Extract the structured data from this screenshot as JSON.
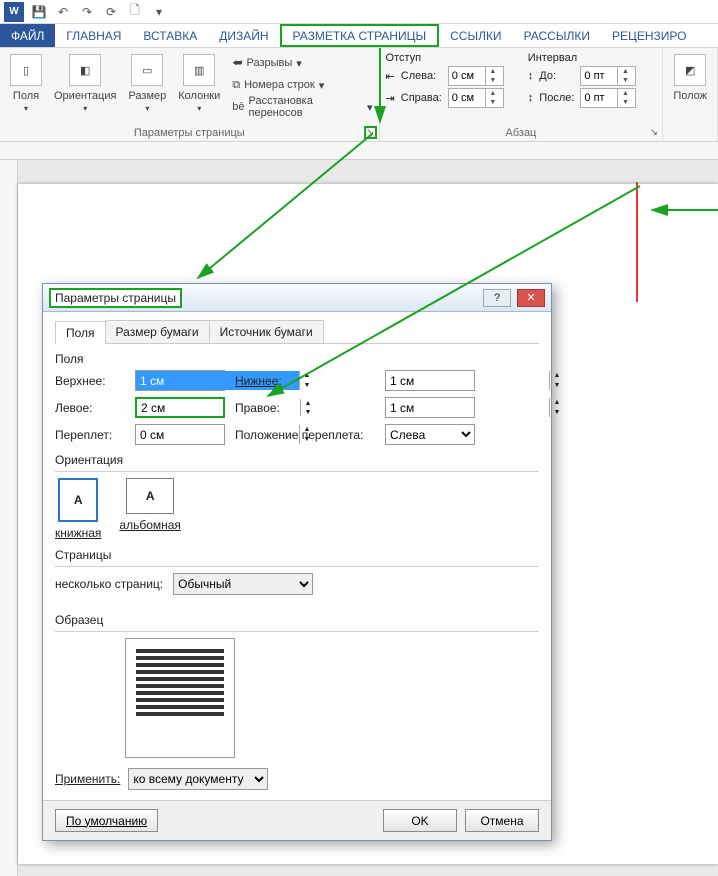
{
  "qat": {
    "app": "W"
  },
  "tabs": {
    "file": "ФАЙЛ",
    "items": [
      "ГЛАВНАЯ",
      "ВСТАВКА",
      "ДИЗАЙН",
      "РАЗМЕТКА СТРАНИЦЫ",
      "ССЫЛКИ",
      "РАССЫЛКИ",
      "РЕЦЕНЗИРО"
    ],
    "active_idx": 3
  },
  "ribbon": {
    "page_setup": {
      "label": "Параметры страницы",
      "margins": "Поля",
      "orientation": "Ориентация",
      "size": "Размер",
      "columns": "Колонки",
      "breaks": "Разрывы",
      "line_numbers": "Номера строк",
      "hyphenation": "Расстановка переносов"
    },
    "paragraph": {
      "label": "Абзац",
      "indent_title": "Отступ",
      "spacing_title": "Интервал",
      "left_label": "Слева:",
      "right_label": "Справа:",
      "before_label": "До:",
      "after_label": "После:",
      "left": "0 см",
      "right": "0 см",
      "before": "0 пт",
      "after": "0 пт"
    },
    "arrange": {
      "position": "Полож"
    }
  },
  "dialog": {
    "title": "Параметры страницы",
    "tabs": [
      "Поля",
      "Размер бумаги",
      "Источник бумаги"
    ],
    "active_tab": 0,
    "frames": {
      "margins": {
        "title": "Поля",
        "top_label": "Верхнее:",
        "top": "1 см",
        "bottom_label": "Нижнее:",
        "bottom": "1 см",
        "left_label": "Левое:",
        "left": "2 см",
        "right_label": "Правое:",
        "right": "1 см",
        "gutter_label": "Переплет:",
        "gutter": "0 см",
        "gutter_pos_label": "Положение переплета:",
        "gutter_pos": "Слева"
      },
      "orientation": {
        "title": "Ориентация",
        "portrait": "книжная",
        "landscape": "альбомная"
      },
      "pages": {
        "title": "Страницы",
        "multi_label": "несколько страниц:",
        "multi_value": "Обычный"
      },
      "preview": {
        "title": "Образец"
      },
      "apply": {
        "label": "Применить:",
        "value": "ко всему документу"
      }
    },
    "buttons": {
      "default": "По умолчанию",
      "ok": "OK",
      "cancel": "Отмена"
    }
  }
}
